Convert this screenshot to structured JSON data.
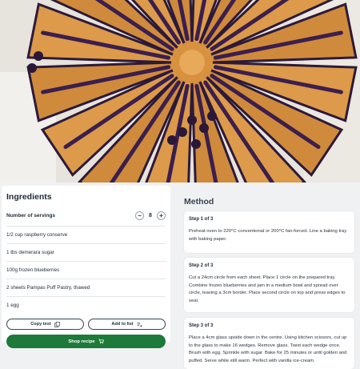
{
  "hero": {
    "icon": "tart-photo"
  },
  "ingredients": {
    "title": "Ingredients",
    "servings_label": "Number of servings",
    "servings_value": "8",
    "minus": "−",
    "plus": "+",
    "items": [
      "1/2 cup raspberry conserve",
      "1 tbs demerara sugar",
      "100g frozen blueberries",
      "2 sheets Pampas Puff Pastry, thawed",
      "1 egg"
    ],
    "copy_text": "Copy text",
    "add_to_list": "Add to list",
    "shop_recipe": "Shop recipe"
  },
  "method": {
    "title": "Method",
    "steps": [
      {
        "label": "Step 1 of 3",
        "text": "Preheat oven to 220°C conventional or 200°C fan-forced. Line a baking tray with baking paper."
      },
      {
        "label": "Step 2 of 3",
        "text": "Cut a 24cm circle from each sheet. Place 1 circle on the prepared tray. Combine frozen blueberries and jam in a medium bowl and spread over circle, leaving a 3cm border. Place second circle on top and press edges to seal."
      },
      {
        "label": "Step 3 of 3",
        "text": "Place a 4cm glass upside down in the centre. Using kitchen scissors, cut up to the glass to make 16 wedges. Remove glass. Twist each wedge once. Brush with egg. Sprinkle with sugar. Bake for 25 minutes or until golden and puffed. Serve while still warm. Perfect with vanilla ice-cream."
      }
    ]
  },
  "colors": {
    "accent": "#1d7a3a",
    "background": "#f0f1f3",
    "card": "#ffffff"
  }
}
